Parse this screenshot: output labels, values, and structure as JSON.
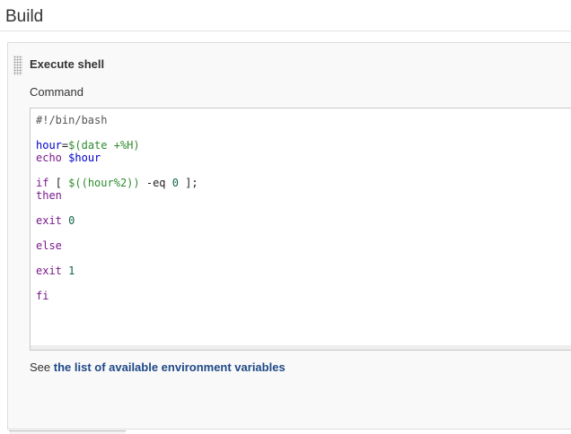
{
  "section": {
    "title": "Build"
  },
  "step": {
    "title": "Execute shell",
    "command_label": "Command"
  },
  "editor": {
    "lines": [
      [
        {
          "t": "#!/bin/bash",
          "c": "comment"
        }
      ],
      [],
      [
        {
          "t": "hour",
          "c": "var"
        },
        {
          "t": "=",
          "c": "plain"
        },
        {
          "t": "$(date +%H)",
          "c": "sub"
        }
      ],
      [
        {
          "t": "echo",
          "c": "kw"
        },
        {
          "t": " ",
          "c": "plain"
        },
        {
          "t": "$hour",
          "c": "var"
        }
      ],
      [],
      [
        {
          "t": "if",
          "c": "kw"
        },
        {
          "t": " [ ",
          "c": "plain"
        },
        {
          "t": "$((hour%2))",
          "c": "sub"
        },
        {
          "t": " -eq ",
          "c": "plain"
        },
        {
          "t": "0",
          "c": "num"
        },
        {
          "t": " ];",
          "c": "plain"
        }
      ],
      [
        {
          "t": "then",
          "c": "kw"
        }
      ],
      [],
      [
        {
          "t": "exit",
          "c": "kw"
        },
        {
          "t": " ",
          "c": "plain"
        },
        {
          "t": "0",
          "c": "num"
        }
      ],
      [],
      [
        {
          "t": "else",
          "c": "kw"
        }
      ],
      [],
      [
        {
          "t": "exit",
          "c": "kw"
        },
        {
          "t": " ",
          "c": "plain"
        },
        {
          "t": "1",
          "c": "num"
        }
      ],
      [],
      [
        {
          "t": "fi",
          "c": "kw"
        }
      ]
    ]
  },
  "env_note": {
    "prefix": "See ",
    "link_text": "the list of available environment variables"
  },
  "colors": {
    "link": "#204a87",
    "code_variable": "#0000cc",
    "code_substitution": "#2e8b2e",
    "code_keyword": "#7a1a8c",
    "code_number": "#116644"
  },
  "icons": {
    "drag_handle": "drag-handle-icon"
  }
}
